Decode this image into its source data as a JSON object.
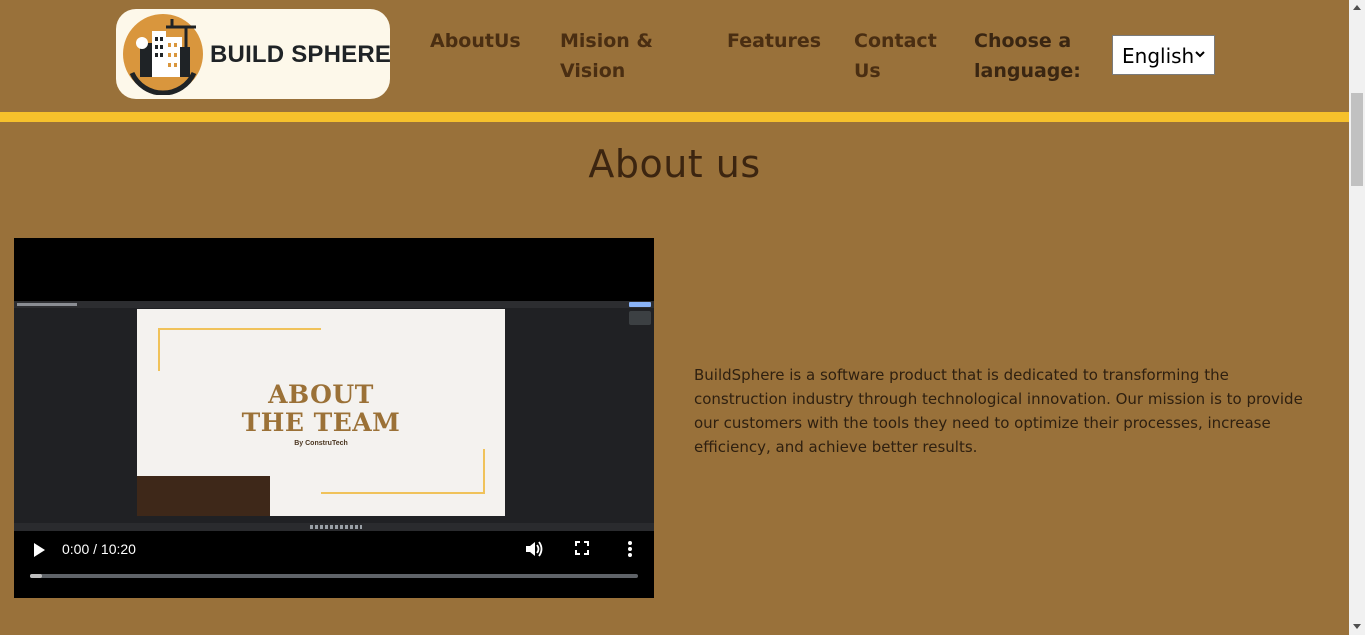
{
  "header": {
    "logo_text": "BUILD SPHERE",
    "nav": [
      "AboutUs",
      "Mision & Vision",
      "Features",
      "Contact Us"
    ],
    "language_label": "Choose a language:",
    "language_selected": "English",
    "stripe_color": "#f6c12c",
    "background_color": "#99713a"
  },
  "main": {
    "title": "About us",
    "video": {
      "slide_title": "ABOUT THE TEAM",
      "slide_subtitle": "By ConstruTech",
      "time": "0:00 / 10:20",
      "progress": 0.02,
      "icons": [
        "play-icon",
        "volume-icon",
        "fullscreen-icon",
        "more-options-icon"
      ]
    },
    "description": "BuildSphere is a software product that is dedicated to transforming the construction industry through technological innovation. Our mission is to provide our customers with the tools they need to optimize their processes, increase efficiency, and achieve better results."
  }
}
